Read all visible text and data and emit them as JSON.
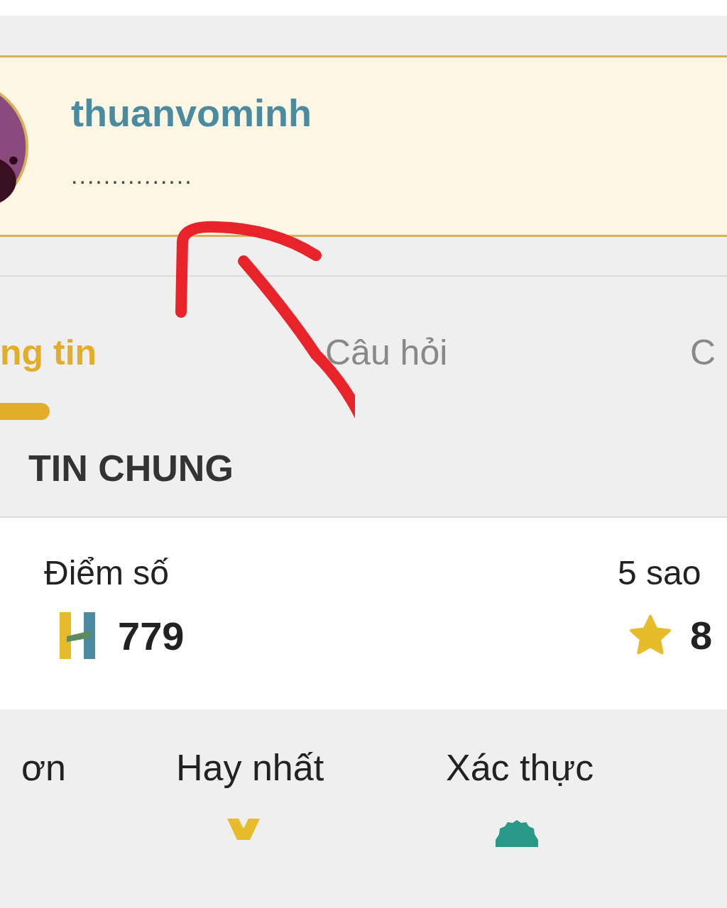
{
  "profile": {
    "username": "thuanvominh",
    "bio": "..............."
  },
  "tabs": [
    {
      "label": "ng tin",
      "selected": true
    },
    {
      "label": "Câu hỏi",
      "selected": false
    },
    {
      "label": "C",
      "selected": false
    }
  ],
  "section_title": "TIN CHUNG",
  "stats": [
    {
      "label": "Điểm số",
      "value": "779",
      "kind": "points"
    },
    {
      "label": "5 sao",
      "value": "8",
      "kind": "stars"
    }
  ],
  "awards": [
    {
      "label": "ơn",
      "kind": "thanks"
    },
    {
      "label": "Hay nhất",
      "kind": "best"
    },
    {
      "label": "Xác thực",
      "kind": "verified"
    }
  ]
}
